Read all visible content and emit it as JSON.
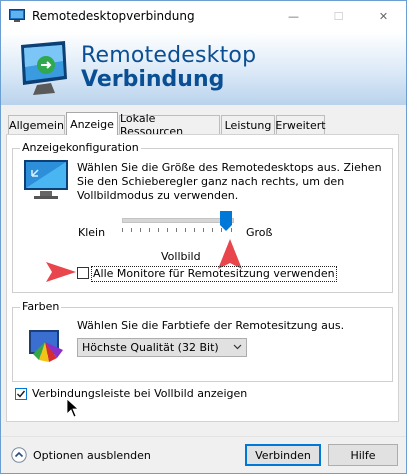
{
  "window": {
    "title": "Remotedesktopverbindung",
    "controls": {
      "minimize": "—",
      "maximize": "☐",
      "close": "✕"
    }
  },
  "banner": {
    "line1": "Remotedesktop",
    "line2": "Verbindung"
  },
  "tabs": [
    {
      "label": "Allgemein",
      "active": false
    },
    {
      "label": "Anzeige",
      "active": true
    },
    {
      "label": "Lokale Ressourcen",
      "active": false
    },
    {
      "label": "Leistung",
      "active": false
    },
    {
      "label": "Erweitert",
      "active": false
    }
  ],
  "display_config": {
    "group_title": "Anzeigekonfiguration",
    "description": "Wählen Sie die Größe des Remotedesktops aus. Ziehen Sie den Schieberegler ganz nach rechts, um den Vollbildmodus zu verwenden.",
    "slider": {
      "min_label": "Klein",
      "max_label": "Groß",
      "value_label": "Vollbild",
      "position": 1.0
    },
    "all_monitors": {
      "label": "Alle Monitore für Remotesitzung verwenden",
      "checked": false
    }
  },
  "colors": {
    "group_title": "Farben",
    "description": "Wählen Sie die Farbtiefe der Remotesitzung aus.",
    "quality_selected": "Höchste Qualität (32 Bit)"
  },
  "connection_bar": {
    "label": "Verbindungsleiste bei Vollbild anzeigen",
    "checked": true
  },
  "footer": {
    "options_label": "Optionen ausblenden",
    "connect_label": "Verbinden",
    "help_label": "Hilfe"
  },
  "accent_color": "#0078d7",
  "annotation_color": "#e8454c"
}
